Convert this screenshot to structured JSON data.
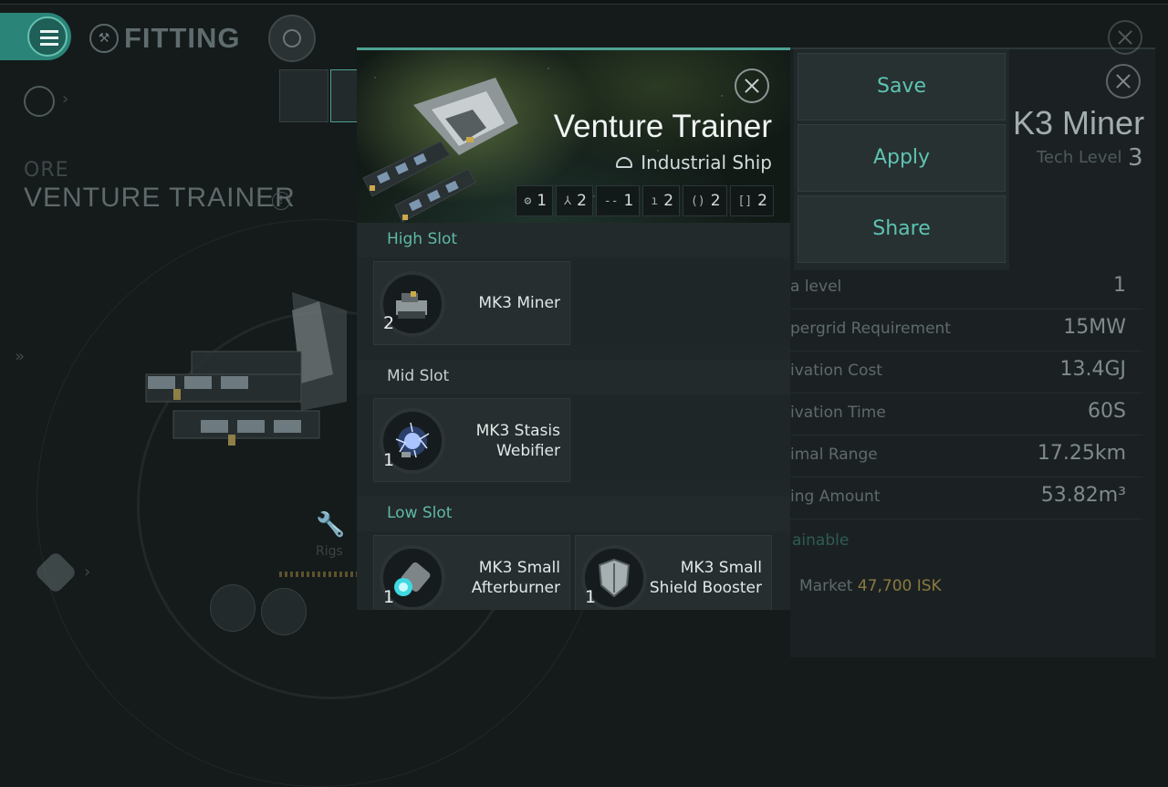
{
  "colors": {
    "accent": "#4da393",
    "teal_text": "#5fc3b2",
    "background": "#151a1b",
    "market_price": "#8a7a3e"
  },
  "nav": {
    "title": "FITTING",
    "menu_icon": "hamburger-icon",
    "fitting_icon": "fitting-icon",
    "target_icon": "target-icon"
  },
  "background_ship": {
    "faction": "ORE",
    "name": "VENTURE TRAINER",
    "rigs_label": "Rigs"
  },
  "action_menu": {
    "save": "Save",
    "apply": "Apply",
    "share": "Share"
  },
  "module_info": {
    "title": "K3 Miner",
    "tech_label": "Tech Level",
    "tech_value": "3",
    "stats": [
      {
        "key": "a level",
        "value": "1"
      },
      {
        "key": "pergrid Requirement",
        "value": "15MW"
      },
      {
        "key": "ivation Cost",
        "value": "13.4GJ"
      },
      {
        "key": "ivation Time",
        "value": "60S"
      },
      {
        "key": "imal Range",
        "value": "17.25km"
      },
      {
        "key": "ing Amount",
        "value": "53.82m³"
      }
    ],
    "obtainable": "ainable",
    "market_label": "Market",
    "market_price": "47,700 ISK"
  },
  "card": {
    "ship_title": "Venture Trainer",
    "ship_class": "Industrial Ship",
    "slot_counts": [
      {
        "icon": "drone-bay-icon",
        "glyph": "⚙",
        "count": "1"
      },
      {
        "icon": "tri-blade-icon",
        "glyph": "⅄",
        "count": "2"
      },
      {
        "icon": "dash-slot-icon",
        "glyph": "--",
        "count": "1"
      },
      {
        "icon": "bar-slot-icon",
        "glyph": "ı",
        "count": "2"
      },
      {
        "icon": "paren-slot-icon",
        "glyph": "()",
        "count": "2"
      },
      {
        "icon": "bracket-slot-icon",
        "glyph": "[]",
        "count": "2"
      }
    ],
    "sections": {
      "high": "High Slot",
      "mid": "Mid Slot",
      "low": "Low Slot"
    },
    "high_modules": [
      {
        "name": "MK3 Miner",
        "qty": "2",
        "icon": "mining-laser-icon"
      }
    ],
    "mid_modules": [
      {
        "name_line1": "MK3 Stasis",
        "name_line2": "Webifier",
        "qty": "1",
        "icon": "stasis-webifier-icon"
      }
    ],
    "low_modules": [
      {
        "name_line1": "MK3 Small",
        "name_line2": "Afterburner",
        "qty": "1",
        "icon": "afterburner-icon"
      },
      {
        "name_line1": "MK3 Small",
        "name_line2": "Shield Booster",
        "qty": "1",
        "icon": "shield-booster-icon"
      }
    ]
  }
}
